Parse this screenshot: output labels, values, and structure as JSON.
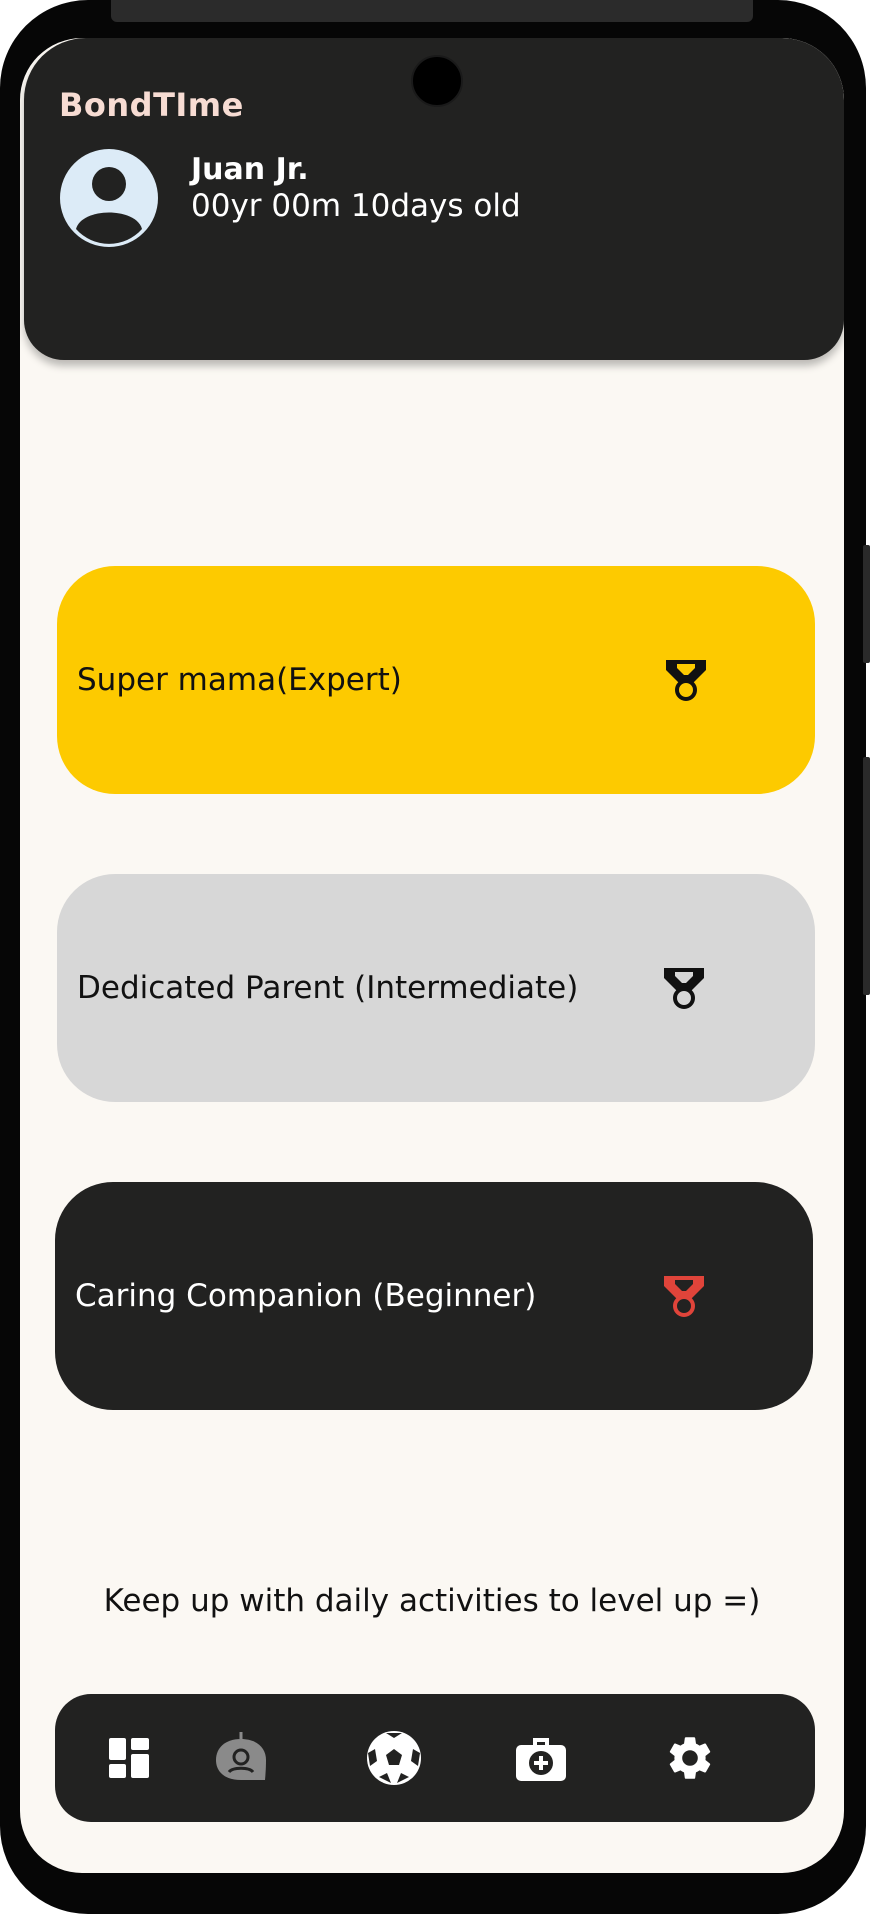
{
  "app": {
    "title": "BondTIme"
  },
  "child": {
    "name": "Juan Jr.",
    "age": "00yr 00m 10days old",
    "avatar_icon": "account-circle-icon"
  },
  "levels": [
    {
      "label": "Super mama(Expert)",
      "bg": "#fdca00",
      "text_color": "#111111",
      "medal_color": "#111111",
      "medal_accent": "#fdca00",
      "icon": "medal-icon"
    },
    {
      "label": "Dedicated Parent (Intermediate)",
      "bg": "#d7d7d7",
      "text_color": "#111111",
      "medal_color": "#111111",
      "medal_accent": "#d7d7d7",
      "icon": "medal-icon"
    },
    {
      "label": "Caring Companion (Beginner)",
      "bg": "#222221",
      "text_color": "#ffffff",
      "medal_color": "#e0443a",
      "medal_accent": "#222221",
      "icon": "medal-icon"
    }
  ],
  "footer": {
    "text": "Keep up with daily activities to level up =)"
  },
  "nav": {
    "items": [
      {
        "icon": "dashboard-icon",
        "active": true
      },
      {
        "icon": "chat-bot-icon",
        "active": false
      },
      {
        "icon": "soccer-ball-icon",
        "active": false
      },
      {
        "icon": "medical-kit-icon",
        "active": false
      },
      {
        "icon": "settings-gear-icon",
        "active": false
      }
    ]
  },
  "colors": {
    "header_bg": "#222221",
    "brand_text": "#f7dcd3",
    "screen_bg": "#fbf8f3"
  }
}
